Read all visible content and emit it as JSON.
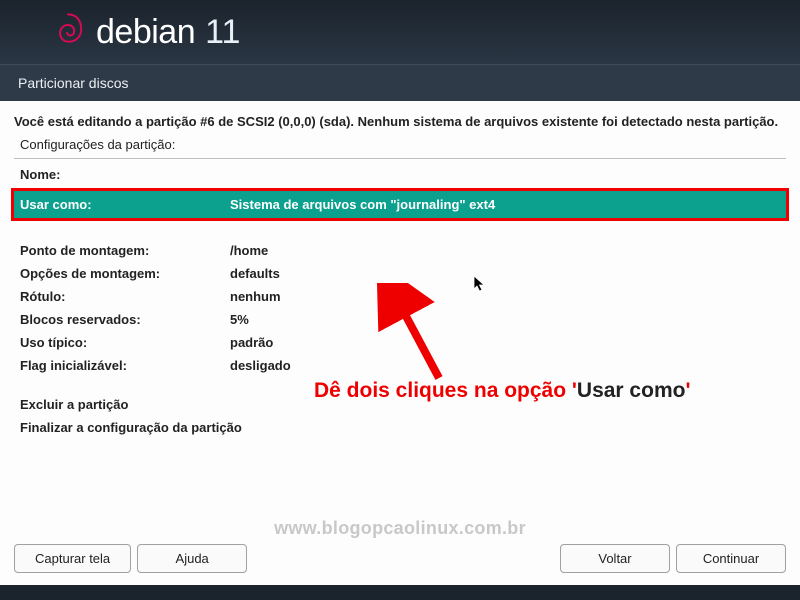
{
  "header": {
    "brand": "debian",
    "version": "11"
  },
  "page_title": "Particionar discos",
  "instruction": "Você está editando a partição #6 de SCSI2 (0,0,0) (sda). Nenhum sistema de arquivos existente foi detectado nesta partição.",
  "subheading": "Configurações da partição:",
  "rows": {
    "name_label": "Nome:",
    "use_as_label": "Usar como:",
    "use_as_value": "Sistema de arquivos com \"journaling\" ext4",
    "mount_point_label": "Ponto de montagem:",
    "mount_point_value": "/home",
    "mount_options_label": "Opções de montagem:",
    "mount_options_value": "defaults",
    "label_label": "Rótulo:",
    "label_value": "nenhum",
    "reserved_blocks_label": "Blocos reservados:",
    "reserved_blocks_value": "5%",
    "typical_usage_label": "Uso típico:",
    "typical_usage_value": "padrão",
    "bootable_flag_label": "Flag inicializável:",
    "bootable_flag_value": "desligado",
    "delete_label": "Excluir a partição",
    "done_label": "Finalizar a configuração da partição"
  },
  "annotation": {
    "prefix": "Dê dois cliques na opção ",
    "quote1": "'",
    "emph": "Usar como",
    "quote2": "'"
  },
  "watermark": "www.blogopcaolinux.com.br",
  "buttons": {
    "screenshot": "Capturar tela",
    "help": "Ajuda",
    "back": "Voltar",
    "continue": "Continuar"
  }
}
